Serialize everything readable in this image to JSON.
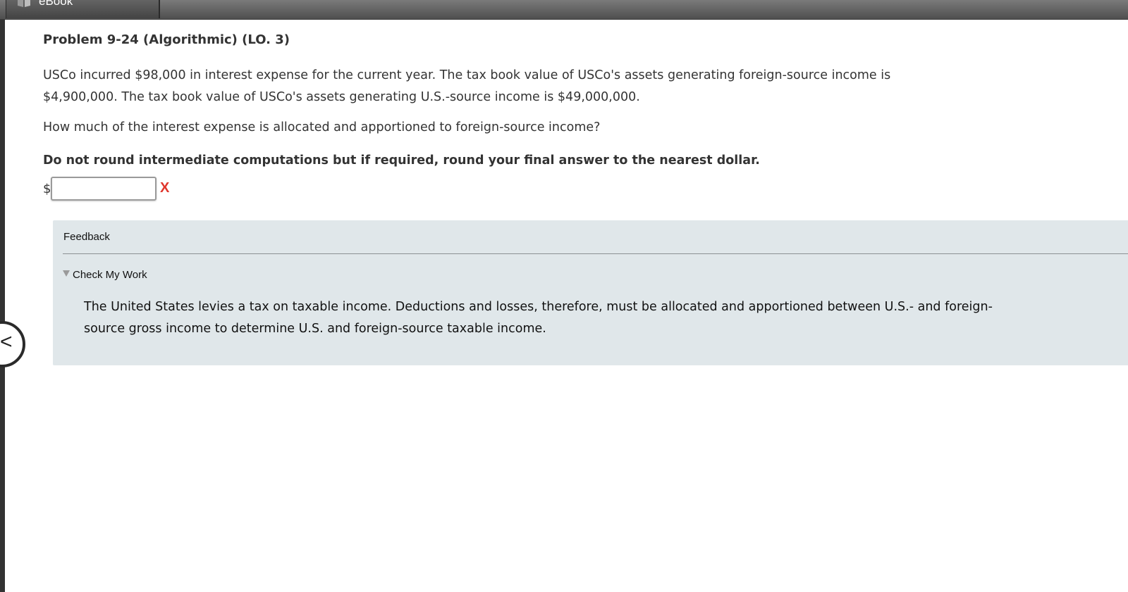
{
  "toolbar": {
    "ebook_label": "eBook"
  },
  "problem": {
    "title": "Problem 9-24 (Algorithmic) (LO. 3)",
    "text_line1": "USCo incurred $98,000 in interest expense for the current year. The tax book value of USCo's assets generating foreign-source income is",
    "text_line2": "$4,900,000. The tax book value of USCo's assets generating U.S.-source income is $49,000,000.",
    "question": "How much of the interest expense is allocated and apportioned to foreign-source income?",
    "instruction": "Do not round intermediate computations but if required, round your final answer to the nearest dollar."
  },
  "answer": {
    "currency_symbol": "$",
    "value": "",
    "status_mark": "X",
    "status_color": "#e0362c"
  },
  "feedback": {
    "title": "Feedback",
    "section_label": "Check My Work",
    "text_line1": "The United States levies a tax on taxable income. Deductions and losses, therefore, must be allocated and apportioned between U.S.- and foreign-",
    "text_line2": "source gross income to determine U.S. and foreign-source taxable income."
  },
  "nav": {
    "back_glyph": "<",
    "back_icon": "chevron-left-icon"
  }
}
